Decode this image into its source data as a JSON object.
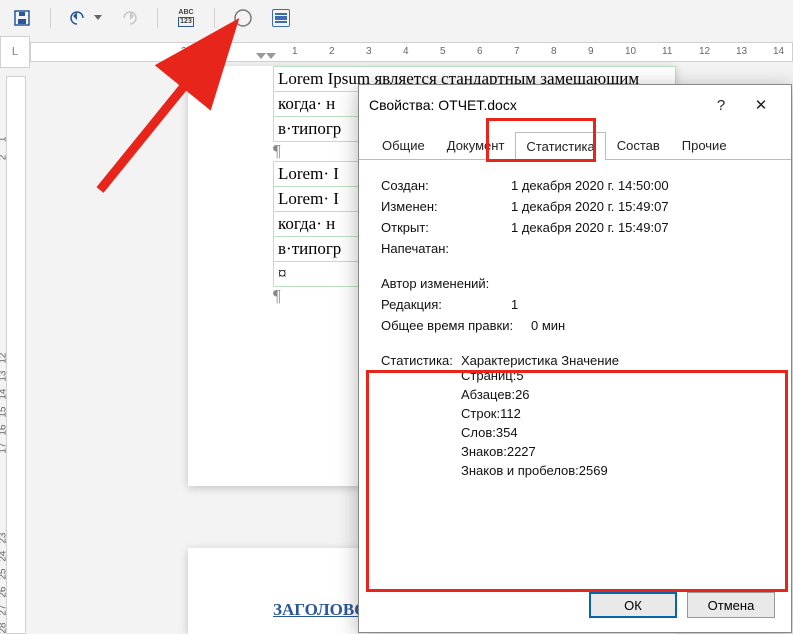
{
  "toolbar": {
    "save_icon": "save",
    "undo_icon": "undo",
    "redo_icon": "redo",
    "spell_top": "ABС",
    "spell_bot": "123"
  },
  "ruler_v_corner": "L",
  "hruler_ticks": [
    "2",
    "1",
    "",
    "1",
    "2",
    "3",
    "4",
    "5",
    "6",
    "7",
    "8",
    "9",
    "10",
    "11",
    "12",
    "13",
    "14"
  ],
  "vruler_ticks": [
    "",
    "",
    "",
    "1",
    "2",
    "",
    "",
    "",
    "",
    "",
    "",
    "",
    "",
    "",
    "",
    "12",
    "13",
    "14",
    "15",
    "16",
    "17",
    "",
    "",
    "",
    "",
    "23",
    "24",
    "25",
    "26",
    "27",
    "28",
    ""
  ],
  "doc": {
    "lines": [
      "Lorem Ipsum является стандартным замещающим",
      "когда· н",
      "в·типогр",
      "¶",
      "Lorem· I",
      "Lorem· I",
      "когда· н",
      "в·типогр",
      "¤",
      "¶"
    ],
    "page2_heading": "ЗАГОЛОВО"
  },
  "dialog": {
    "title": "Свойства: ОТЧЕТ.docx",
    "help": "?",
    "close": "✕",
    "tabs": [
      "Общие",
      "Документ",
      "Статистика",
      "Состав",
      "Прочие"
    ],
    "active_tab": 2,
    "fields": {
      "created_l": "Создан:",
      "created_v": "1 декабря 2020 г. 14:50:00",
      "modified_l": "Изменен:",
      "modified_v": "1 декабря 2020 г. 15:49:07",
      "opened_l": "Открыт:",
      "opened_v": "1 декабря 2020 г. 15:49:07",
      "printed_l": "Напечатан:",
      "printed_v": "",
      "author_l": "Автор изменений:",
      "author_v": "",
      "revision_l": "Редакция:",
      "revision_v": "1",
      "edit_time_l": "Общее время правки:",
      "edit_time_v": "0 мин"
    },
    "stats_label": "Статистика:",
    "stats_header_char": "Характеристика",
    "stats_header_val": "Значение",
    "stats_rows": [
      {
        "k": "Страниц:",
        "v": "5"
      },
      {
        "k": "Абзацев:",
        "v": "26"
      },
      {
        "k": "Строк:",
        "v": "112"
      },
      {
        "k": "Слов:",
        "v": "354"
      },
      {
        "k": "Знаков:",
        "v": "2227"
      },
      {
        "k": "Знаков и пробелов:",
        "v": "2569"
      }
    ],
    "ok": "ОК",
    "cancel": "Отмена"
  }
}
